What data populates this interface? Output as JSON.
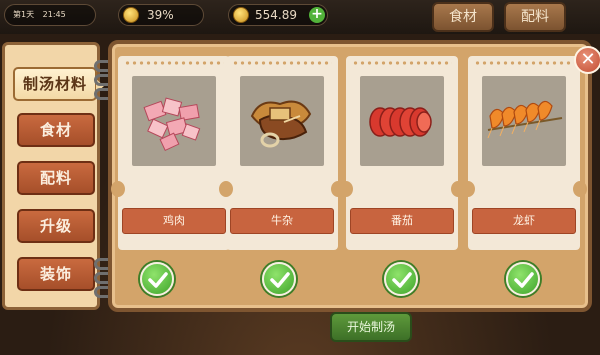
{
  "hud": {
    "day_label": "第1天",
    "time_label": "21:45",
    "percent": "39%",
    "money": "554.89",
    "plus_icon": "plus-icon",
    "food_button": "食材",
    "seasoning_button": "配料"
  },
  "menu": {
    "items": [
      {
        "label": "制汤材料",
        "active": true
      },
      {
        "label": "食材",
        "active": false
      },
      {
        "label": "配料",
        "active": false
      },
      {
        "label": "升级",
        "active": false
      },
      {
        "label": "装饰",
        "active": false
      }
    ]
  },
  "ingredients": [
    {
      "name": "鸡肉",
      "icon": "chicken-meat-icon",
      "selected": true
    },
    {
      "name": "牛杂",
      "icon": "beef-offal-icon",
      "selected": true
    },
    {
      "name": "番茄",
      "icon": "tomato-slices-icon",
      "selected": true
    },
    {
      "name": "龙虾",
      "icon": "lobster-skewer-icon",
      "selected": true
    }
  ],
  "bottom": {
    "start_button": "开始制汤"
  },
  "close_icon": "close-icon",
  "colors": {
    "accent_red": "#c8643f",
    "panel_tan": "#d3a46a",
    "check_green": "#3ea42b"
  }
}
